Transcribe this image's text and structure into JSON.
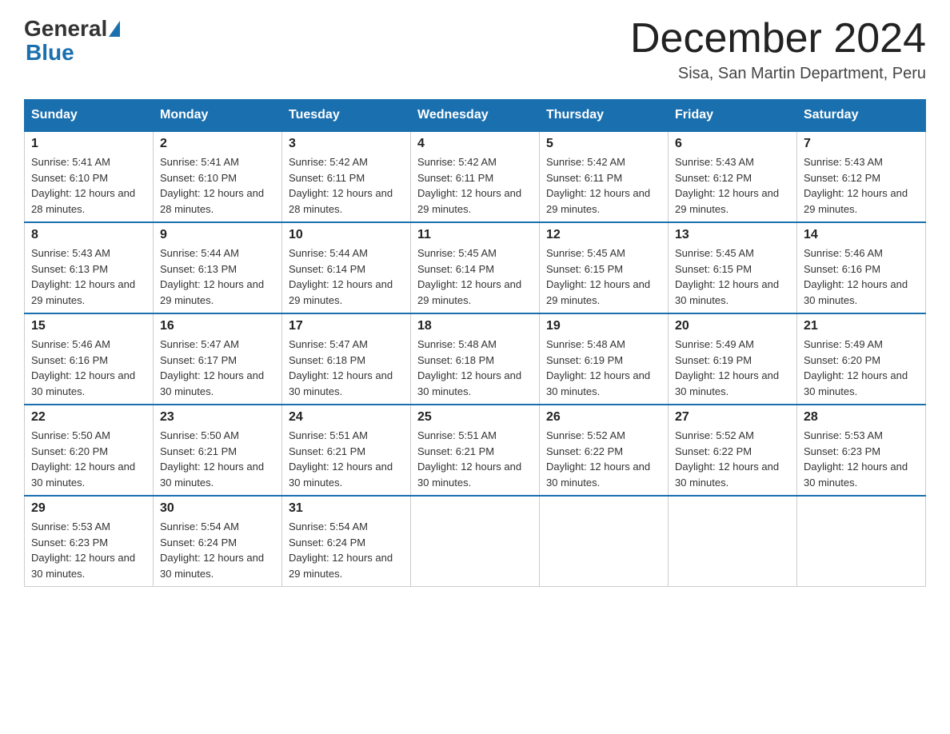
{
  "header": {
    "logo": {
      "general": "General",
      "blue": "Blue"
    },
    "title": "December 2024",
    "location": "Sisa, San Martin Department, Peru"
  },
  "days_of_week": [
    "Sunday",
    "Monday",
    "Tuesday",
    "Wednesday",
    "Thursday",
    "Friday",
    "Saturday"
  ],
  "weeks": [
    [
      {
        "num": "1",
        "sunrise": "5:41 AM",
        "sunset": "6:10 PM",
        "daylight": "12 hours and 28 minutes."
      },
      {
        "num": "2",
        "sunrise": "5:41 AM",
        "sunset": "6:10 PM",
        "daylight": "12 hours and 28 minutes."
      },
      {
        "num": "3",
        "sunrise": "5:42 AM",
        "sunset": "6:11 PM",
        "daylight": "12 hours and 28 minutes."
      },
      {
        "num": "4",
        "sunrise": "5:42 AM",
        "sunset": "6:11 PM",
        "daylight": "12 hours and 29 minutes."
      },
      {
        "num": "5",
        "sunrise": "5:42 AM",
        "sunset": "6:11 PM",
        "daylight": "12 hours and 29 minutes."
      },
      {
        "num": "6",
        "sunrise": "5:43 AM",
        "sunset": "6:12 PM",
        "daylight": "12 hours and 29 minutes."
      },
      {
        "num": "7",
        "sunrise": "5:43 AM",
        "sunset": "6:12 PM",
        "daylight": "12 hours and 29 minutes."
      }
    ],
    [
      {
        "num": "8",
        "sunrise": "5:43 AM",
        "sunset": "6:13 PM",
        "daylight": "12 hours and 29 minutes."
      },
      {
        "num": "9",
        "sunrise": "5:44 AM",
        "sunset": "6:13 PM",
        "daylight": "12 hours and 29 minutes."
      },
      {
        "num": "10",
        "sunrise": "5:44 AM",
        "sunset": "6:14 PM",
        "daylight": "12 hours and 29 minutes."
      },
      {
        "num": "11",
        "sunrise": "5:45 AM",
        "sunset": "6:14 PM",
        "daylight": "12 hours and 29 minutes."
      },
      {
        "num": "12",
        "sunrise": "5:45 AM",
        "sunset": "6:15 PM",
        "daylight": "12 hours and 29 minutes."
      },
      {
        "num": "13",
        "sunrise": "5:45 AM",
        "sunset": "6:15 PM",
        "daylight": "12 hours and 30 minutes."
      },
      {
        "num": "14",
        "sunrise": "5:46 AM",
        "sunset": "6:16 PM",
        "daylight": "12 hours and 30 minutes."
      }
    ],
    [
      {
        "num": "15",
        "sunrise": "5:46 AM",
        "sunset": "6:16 PM",
        "daylight": "12 hours and 30 minutes."
      },
      {
        "num": "16",
        "sunrise": "5:47 AM",
        "sunset": "6:17 PM",
        "daylight": "12 hours and 30 minutes."
      },
      {
        "num": "17",
        "sunrise": "5:47 AM",
        "sunset": "6:18 PM",
        "daylight": "12 hours and 30 minutes."
      },
      {
        "num": "18",
        "sunrise": "5:48 AM",
        "sunset": "6:18 PM",
        "daylight": "12 hours and 30 minutes."
      },
      {
        "num": "19",
        "sunrise": "5:48 AM",
        "sunset": "6:19 PM",
        "daylight": "12 hours and 30 minutes."
      },
      {
        "num": "20",
        "sunrise": "5:49 AM",
        "sunset": "6:19 PM",
        "daylight": "12 hours and 30 minutes."
      },
      {
        "num": "21",
        "sunrise": "5:49 AM",
        "sunset": "6:20 PM",
        "daylight": "12 hours and 30 minutes."
      }
    ],
    [
      {
        "num": "22",
        "sunrise": "5:50 AM",
        "sunset": "6:20 PM",
        "daylight": "12 hours and 30 minutes."
      },
      {
        "num": "23",
        "sunrise": "5:50 AM",
        "sunset": "6:21 PM",
        "daylight": "12 hours and 30 minutes."
      },
      {
        "num": "24",
        "sunrise": "5:51 AM",
        "sunset": "6:21 PM",
        "daylight": "12 hours and 30 minutes."
      },
      {
        "num": "25",
        "sunrise": "5:51 AM",
        "sunset": "6:21 PM",
        "daylight": "12 hours and 30 minutes."
      },
      {
        "num": "26",
        "sunrise": "5:52 AM",
        "sunset": "6:22 PM",
        "daylight": "12 hours and 30 minutes."
      },
      {
        "num": "27",
        "sunrise": "5:52 AM",
        "sunset": "6:22 PM",
        "daylight": "12 hours and 30 minutes."
      },
      {
        "num": "28",
        "sunrise": "5:53 AM",
        "sunset": "6:23 PM",
        "daylight": "12 hours and 30 minutes."
      }
    ],
    [
      {
        "num": "29",
        "sunrise": "5:53 AM",
        "sunset": "6:23 PM",
        "daylight": "12 hours and 30 minutes."
      },
      {
        "num": "30",
        "sunrise": "5:54 AM",
        "sunset": "6:24 PM",
        "daylight": "12 hours and 30 minutes."
      },
      {
        "num": "31",
        "sunrise": "5:54 AM",
        "sunset": "6:24 PM",
        "daylight": "12 hours and 29 minutes."
      },
      null,
      null,
      null,
      null
    ]
  ],
  "labels": {
    "sunrise": "Sunrise:",
    "sunset": "Sunset:",
    "daylight": "Daylight:"
  }
}
